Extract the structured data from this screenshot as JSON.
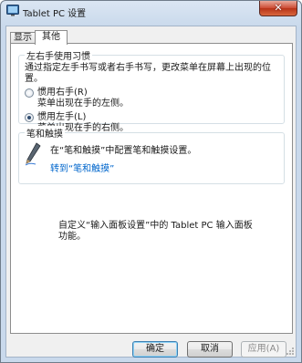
{
  "window": {
    "title": "Tablet PC 设置",
    "close_symbol": "✕"
  },
  "tabs": [
    {
      "label": "显示",
      "selected": false
    },
    {
      "label": "其他",
      "selected": true
    }
  ],
  "handedness": {
    "group_title": "左右手使用习惯",
    "description": "通过指定左手书写或者右手书写，更改菜单在屏幕上出现的位置。",
    "options": [
      {
        "label": "惯用右手(R)",
        "sublabel": "菜单出现在手的左侧。",
        "checked": false
      },
      {
        "label": "惯用左手(L)",
        "sublabel": "菜单出现在手的右侧。",
        "checked": true
      }
    ]
  },
  "pen": {
    "group_title": "笔和触摸",
    "text": "在“笔和触摸”中配置笔和触摸设置。",
    "link": "转到“笔和触摸”",
    "icon": "pen-icon"
  },
  "custom": {
    "text": "自定义“输入面板设置”中的 Tablet PC 输入面板功能。"
  },
  "buttons": {
    "ok": "确定",
    "cancel": "取消",
    "apply": "应用(A)"
  },
  "colors": {
    "link": "#0066cc",
    "close": "#c7432a",
    "frame": "#c9d9ec"
  }
}
